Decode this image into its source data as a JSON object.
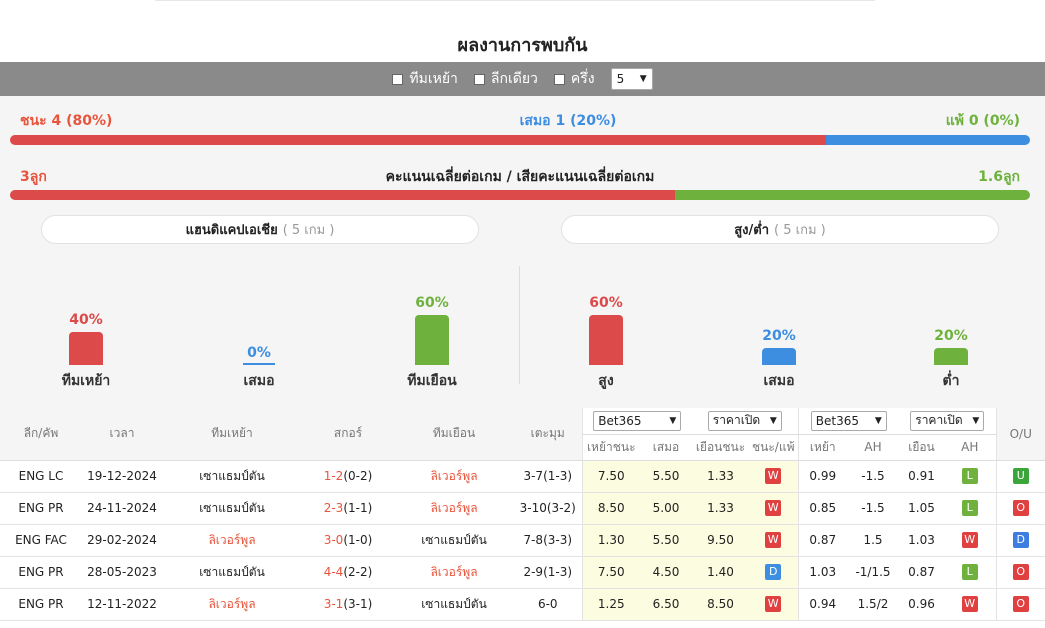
{
  "page": {
    "title": "ผลงานการพบกัน"
  },
  "filters": {
    "home_label": "ทีมเหย้า",
    "league_label": "ลีกเดียว",
    "half_label": "ครึ่ง",
    "count_value": "5"
  },
  "summary": {
    "win": "ชนะ 4 (80%)",
    "draw": "เสมอ 1 (20%)",
    "loss": "แพ้ 0 (0%)",
    "win_fraction": 0.8,
    "draw_fraction": 0.2,
    "avg_home": "3ลูก",
    "avg_center": "คะแนนเฉลี่ยต่อเกม / เสียคะแนนเฉลี่ยต่อเกม",
    "avg_away": "1.6ลูก",
    "avg_home_fraction": 0.652
  },
  "handicap": {
    "title": "แฮนดิแคปเอเชีย",
    "count": "( 5 เกม )",
    "items": [
      {
        "pct": "40%",
        "label": "ทีมเหย้า",
        "color": "#dc4a4a",
        "value": 0.4
      },
      {
        "pct": "0%",
        "label": "เสมอ",
        "color": "#3d8de0",
        "value": 0
      },
      {
        "pct": "60%",
        "label": "ทีมเยือน",
        "color": "#6eb23d",
        "value": 0.6
      }
    ]
  },
  "overunder": {
    "title": "สูง/ต่ำ",
    "count": "( 5 เกม )",
    "items": [
      {
        "pct": "60%",
        "label": "สูง",
        "color": "#dc4a4a",
        "value": 0.6
      },
      {
        "pct": "20%",
        "label": "เสมอ",
        "color": "#3d8de0",
        "value": 0.2
      },
      {
        "pct": "20%",
        "label": "ต่ำ",
        "color": "#6eb23d",
        "value": 0.2
      }
    ]
  },
  "table": {
    "headers": {
      "league": "ลีก/คัพ",
      "time": "เวลา",
      "home": "ทีมเหย้า",
      "score": "สกอร์",
      "away": "ทีมเยือน",
      "corner": "เตะมุม",
      "bookmaker1": "Bet365",
      "price1": "ราคาเปิด",
      "bookmaker2": "Bet365",
      "price2": "ราคาเปิด",
      "ou": "O/U",
      "home_win": "เหย้าชนะ",
      "draw": "เสมอ",
      "away_win": "เยือนชนะ",
      "wl": "ชนะ/แพ้",
      "home2": "เหย้า",
      "ah": "AH",
      "away2": "เยือน",
      "ah2": "AH"
    },
    "rows": [
      {
        "league": "ENG LC",
        "date": "19-12-2024",
        "home": "เซาแธมป์ตัน",
        "home_orange": false,
        "score_ft": "1-2",
        "score_ht": "(0-2)",
        "away": "ลิเวอร์พูล",
        "away_orange": true,
        "corner": "3-7(1-3)",
        "o1": "7.50",
        "o2": "5.50",
        "o3": "1.33",
        "wl": "W",
        "h": "0.99",
        "ah": "-1.5",
        "a": "0.91",
        "ahr": "L",
        "ou": "U"
      },
      {
        "league": "ENG PR",
        "date": "24-11-2024",
        "home": "เซาแธมป์ตัน",
        "home_orange": false,
        "score_ft": "2-3",
        "score_ht": "(1-1)",
        "away": "ลิเวอร์พูล",
        "away_orange": true,
        "corner": "3-10(3-2)",
        "o1": "8.50",
        "o2": "5.00",
        "o3": "1.33",
        "wl": "W",
        "h": "0.85",
        "ah": "-1.5",
        "a": "1.05",
        "ahr": "L",
        "ou": "O"
      },
      {
        "league": "ENG FAC",
        "date": "29-02-2024",
        "home": "ลิเวอร์พูล",
        "home_orange": true,
        "score_ft": "3-0",
        "score_ht": "(1-0)",
        "away": "เซาแธมป์ตัน",
        "away_orange": false,
        "corner": "7-8(3-3)",
        "o1": "1.30",
        "o2": "5.50",
        "o3": "9.50",
        "wl": "W",
        "h": "0.87",
        "ah": "1.5",
        "a": "1.03",
        "ahr": "W",
        "ou": "D"
      },
      {
        "league": "ENG PR",
        "date": "28-05-2023",
        "home": "เซาแธมป์ตัน",
        "home_orange": false,
        "score_ft": "4-4",
        "score_ht": "(2-2)",
        "away": "ลิเวอร์พูล",
        "away_orange": true,
        "corner": "2-9(1-3)",
        "o1": "7.50",
        "o2": "4.50",
        "o3": "1.40",
        "wl": "D",
        "h": "1.03",
        "ah": "-1/1.5",
        "a": "0.87",
        "ahr": "L",
        "ou": "O"
      },
      {
        "league": "ENG PR",
        "date": "12-11-2022",
        "home": "ลิเวอร์พูล",
        "home_orange": true,
        "score_ft": "3-1",
        "score_ht": "(3-1)",
        "away": "เซาแธมป์ตัน",
        "away_orange": false,
        "corner": "6-0",
        "o1": "1.25",
        "o2": "6.50",
        "o3": "8.50",
        "wl": "W",
        "h": "0.94",
        "ah": "1.5/2",
        "a": "0.96",
        "ahr": "W",
        "ou": "O"
      }
    ]
  }
}
